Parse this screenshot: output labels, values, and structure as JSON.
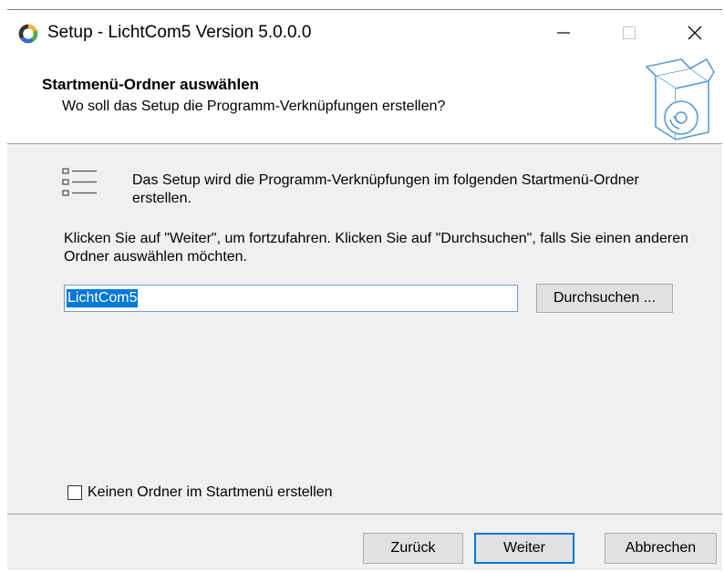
{
  "window": {
    "title": "Setup - LichtCom5 Version 5.0.0.0",
    "minimize_glyph": "—",
    "maximize_glyph": "☐",
    "close_glyph": "✕"
  },
  "header": {
    "title": "Startmenü-Ordner auswählen",
    "subtitle": "Wo soll das Setup die Programm-Verknüpfungen erstellen?"
  },
  "content": {
    "intro": "Das Setup wird die Programm-Verknüpfungen im folgenden Startmenü-Ordner erstellen.",
    "info": "Klicken Sie auf \"Weiter\", um fortzufahren. Klicken Sie auf \"Durchsuchen\", falls Sie einen anderen Ordner auswählen möchten.",
    "folder_value": "LichtCom5",
    "browse_label": "Durchsuchen ...",
    "no_folder_label": "Keinen Ordner im Startmenü erstellen",
    "no_folder_checked": false
  },
  "footer": {
    "back_label": "Zurück",
    "next_label": "Weiter",
    "cancel_label": "Abbrechen"
  },
  "colors": {
    "accent": "#0078d7",
    "dialog_bg": "#f0f0f0",
    "button_bg": "#e1e1e1"
  },
  "icons": {
    "app": "setup-ring-icon",
    "header": "software-box-disc-icon",
    "list": "list-icon"
  }
}
